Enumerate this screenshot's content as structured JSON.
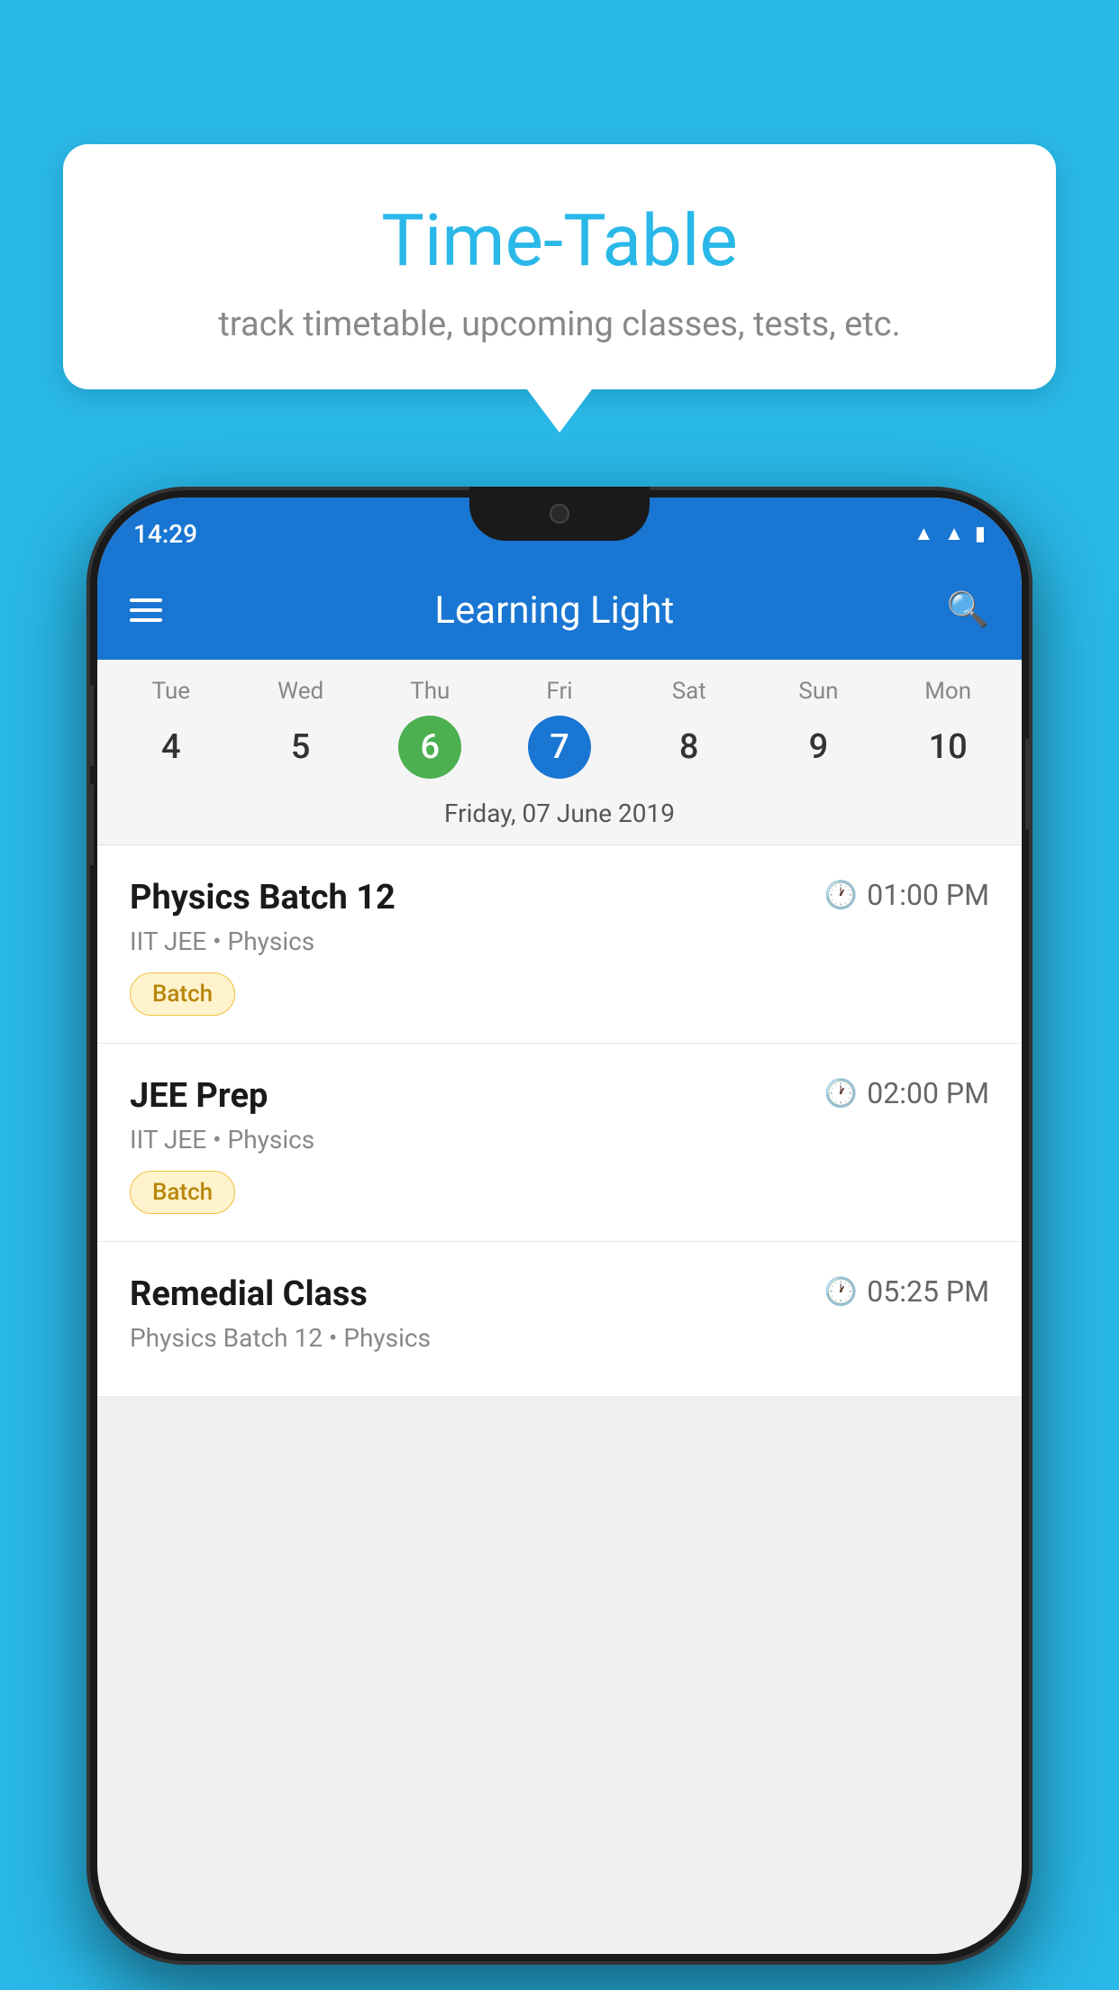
{
  "background_color": "#29B8E8",
  "tooltip": {
    "title": "Time-Table",
    "subtitle": "track timetable, upcoming classes, tests, etc."
  },
  "app": {
    "status_time": "14:29",
    "app_name": "Learning Light",
    "hamburger_label": "menu",
    "search_label": "search"
  },
  "calendar": {
    "days": [
      {
        "label": "Tue",
        "number": "4",
        "state": "normal"
      },
      {
        "label": "Wed",
        "number": "5",
        "state": "normal"
      },
      {
        "label": "Thu",
        "number": "6",
        "state": "today"
      },
      {
        "label": "Fri",
        "number": "7",
        "state": "selected"
      },
      {
        "label": "Sat",
        "number": "8",
        "state": "normal"
      },
      {
        "label": "Sun",
        "number": "9",
        "state": "normal"
      },
      {
        "label": "Mon",
        "number": "10",
        "state": "normal"
      }
    ],
    "selected_date_label": "Friday, 07 June 2019"
  },
  "events": [
    {
      "title": "Physics Batch 12",
      "time": "01:00 PM",
      "subtitle": "IIT JEE • Physics",
      "badge": "Batch"
    },
    {
      "title": "JEE Prep",
      "time": "02:00 PM",
      "subtitle": "IIT JEE • Physics",
      "badge": "Batch"
    },
    {
      "title": "Remedial Class",
      "time": "05:25 PM",
      "subtitle": "Physics Batch 12 • Physics",
      "badge": ""
    }
  ]
}
